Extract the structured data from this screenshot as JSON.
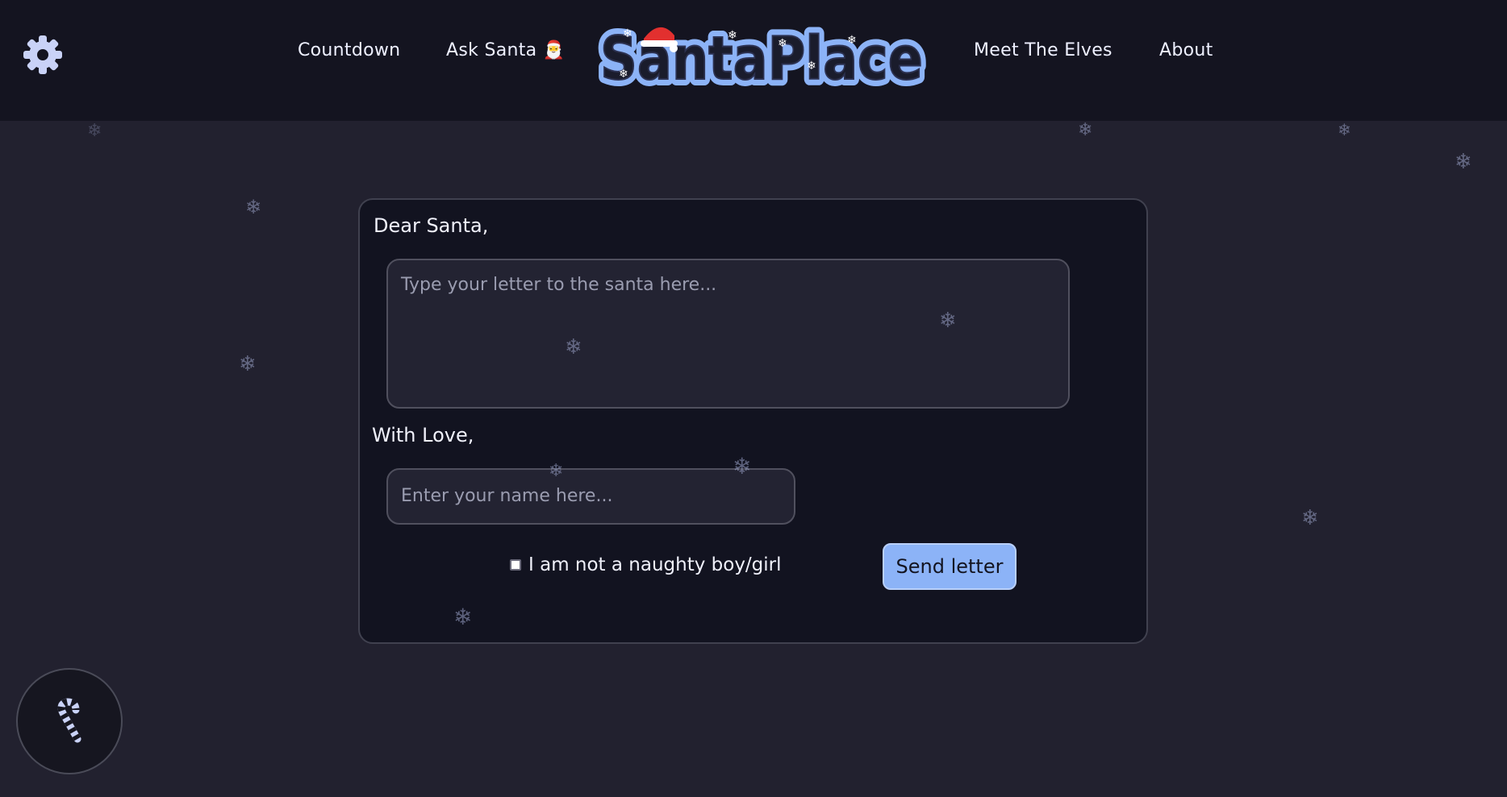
{
  "header": {
    "nav": {
      "countdown": "Countdown",
      "ask_santa": "Ask Santa",
      "ask_santa_emoji": "🎅",
      "meet_elves": "Meet The Elves",
      "about": "About"
    },
    "logo_text": "SantaPlace"
  },
  "letter": {
    "greeting": "Dear Santa,",
    "body_placeholder": "Type your letter to the santa here...",
    "closing": "With Love,",
    "name_placeholder": "Enter your name here...",
    "checkbox_label": "I am not a naughty boy/girl",
    "send_label": "Send letter"
  },
  "snowflake_glyph": "❄",
  "colors": {
    "background": "#22212f",
    "header": "#141420",
    "card": "#121320",
    "accent": "#8cb3f7",
    "logo_fill": "#8cb3f7"
  }
}
